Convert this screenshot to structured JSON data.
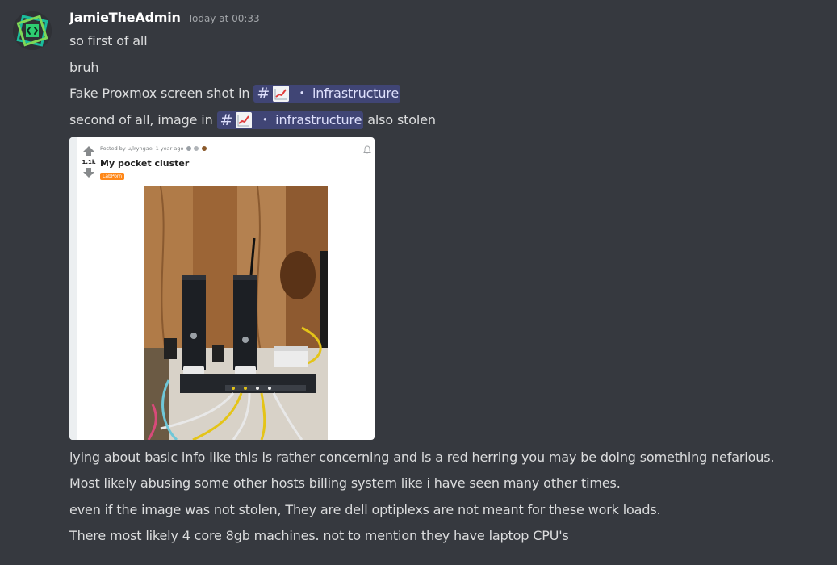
{
  "message": {
    "author": "JamieTheAdmin",
    "timestamp": "Today at 00:33",
    "lines_before": [
      "so first of all",
      "bruh"
    ],
    "line3_text": "Fake Proxmox screen shot in",
    "line4_text_before": "second of all, image in",
    "line4_text_after": "also stolen",
    "channel": {
      "hash": "#",
      "separator": "・",
      "name": "infrastructure",
      "emoji_icon": "chart-increasing-emoji-icon"
    },
    "lines_after": [
      "lying about basic info like this is rather concerning and is a red herring you may be doing something nefarious.",
      "Most likely abusing some other hosts billing system like i have seen many other times.",
      "even if the image was not stolen, They are dell optiplexs are not meant for these work loads.",
      "There most likely 4 core 8gb machines. not to mention they have laptop CPU's"
    ]
  },
  "attachment": {
    "post_meta": "Posted by u/lryngael 1 year ago",
    "vote_count": "1.1k",
    "post_title": "My pocket cluster",
    "flair": "LabPorn"
  },
  "colors": {
    "background": "#36393f",
    "text": "#dcddde",
    "username": "#ffffff",
    "timestamp": "#a3a6aa",
    "mention_bg": "rgba(88,101,242,0.3)",
    "mention_text": "#dee0fc",
    "avatar_accent": "#3ba55c"
  }
}
